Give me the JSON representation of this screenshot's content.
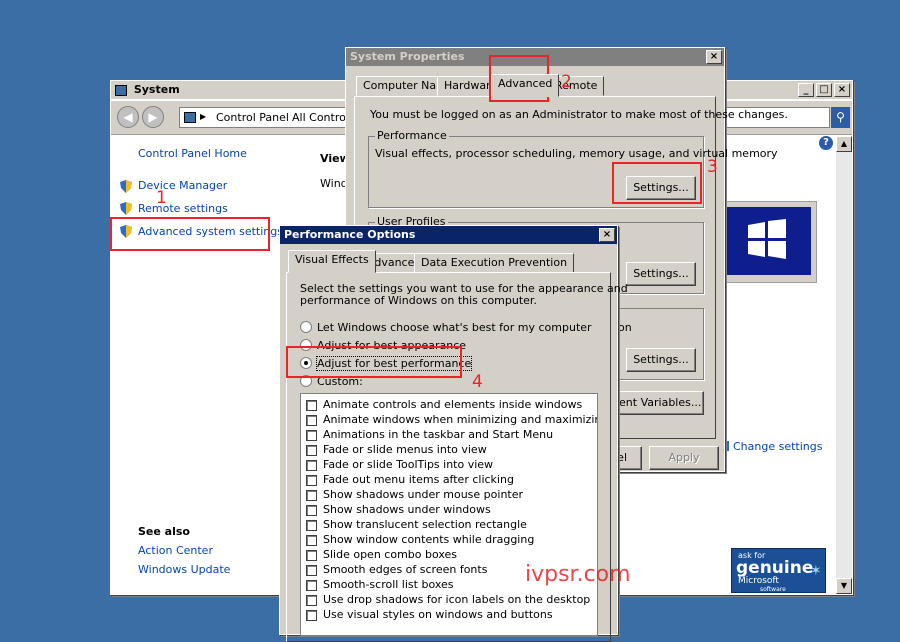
{
  "system_window": {
    "title": "System",
    "address": {
      "crumb1": "Control Panel",
      "crumb2": "All Control P"
    },
    "left": {
      "home_link": "Control Panel Home",
      "links": [
        "Device Manager",
        "Remote settings",
        "Advanced system settings"
      ],
      "see_also_heading": "See also",
      "see_also": [
        "Action Center",
        "Windows Update"
      ]
    },
    "right": {
      "view_text": "View",
      "windo_text": "Windo",
      "change_settings": "Change settings"
    },
    "genuine_badge": {
      "line1": "ask for",
      "line2": "genuine",
      "line3": "Microsoft",
      "line4": "software"
    }
  },
  "sysprops": {
    "title": "System Properties",
    "tabs": [
      "Computer Name",
      "Hardware",
      "Advanced",
      "Remote"
    ],
    "selected_tab": "Advanced",
    "admin_note": "You must be logged on as an Administrator to make most of these changes.",
    "performance": {
      "label": "Performance",
      "desc": "Visual effects, processor scheduling, memory usage, and virtual memory",
      "button": "Settings..."
    },
    "user_profiles": {
      "label": "User Profiles",
      "button": "Settings..."
    },
    "startup": {
      "partial_text": "on",
      "button": "Settings..."
    },
    "env_button": "onment Variables...",
    "cancel_partial": "el",
    "apply_button": "Apply"
  },
  "perf_options": {
    "title": "Performance Options",
    "tabs": [
      "Visual Effects",
      "Advanced",
      "Data Execution Prevention"
    ],
    "intro": [
      "Select the settings you want to use for the appearance and",
      "performance of Windows on this computer."
    ],
    "radios": [
      {
        "label": "Let Windows choose what's best for my computer",
        "checked": false
      },
      {
        "label": "Adjust for best appearance",
        "checked": false
      },
      {
        "label": "Adjust for best performance",
        "checked": true
      },
      {
        "label": "Custom:",
        "checked": false
      }
    ],
    "checkboxes": [
      "Animate controls and elements inside windows",
      "Animate windows when minimizing and maximizing",
      "Animations in the taskbar and Start Menu",
      "Fade or slide menus into view",
      "Fade or slide ToolTips into view",
      "Fade out menu items after clicking",
      "Show shadows under mouse pointer",
      "Show shadows under windows",
      "Show translucent selection rectangle",
      "Show window contents while dragging",
      "Slide open combo boxes",
      "Smooth edges of screen fonts",
      "Smooth-scroll list boxes",
      "Use drop shadows for icon labels on the desktop",
      "Use visual styles on windows and buttons"
    ]
  },
  "annotations": {
    "n1": "1",
    "n2": "2",
    "n3": "3",
    "n4": "4",
    "watermark": "ivpsr.com"
  }
}
